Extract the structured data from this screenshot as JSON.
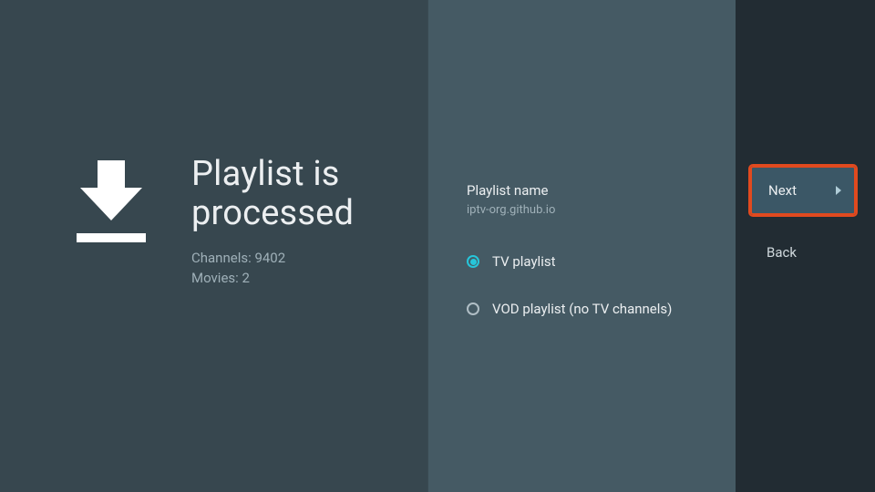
{
  "left": {
    "title_line1": "Playlist is",
    "title_line2": "processed",
    "channels_label": "Channels: 9402",
    "movies_label": "Movies: 2"
  },
  "mid": {
    "playlist_name_label": "Playlist name",
    "playlist_name_value": "iptv-org.github.io",
    "radio_tv": "TV playlist",
    "radio_vod": "VOD playlist (no TV channels)"
  },
  "right": {
    "next_label": "Next",
    "back_label": "Back"
  }
}
